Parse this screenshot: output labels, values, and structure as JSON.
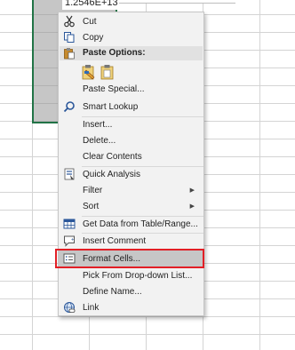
{
  "cell": {
    "value": "1.2546E+13"
  },
  "context_menu": {
    "items": [
      {
        "id": "cut",
        "label": "Cut",
        "icon": "scissors-icon"
      },
      {
        "id": "copy",
        "label": "Copy",
        "icon": "copy-icon"
      },
      {
        "id": "paste_options",
        "label": "Paste Options:",
        "icon": "paste-icon"
      },
      {
        "id": "paste_special",
        "label": "Paste Special..."
      },
      {
        "id": "smart_lookup",
        "label": "Smart Lookup",
        "icon": "search-icon"
      },
      {
        "id": "insert",
        "label": "Insert..."
      },
      {
        "id": "delete",
        "label": "Delete..."
      },
      {
        "id": "clear_contents",
        "label": "Clear Contents"
      },
      {
        "id": "quick_analysis",
        "label": "Quick Analysis",
        "icon": "quick-analysis-icon"
      },
      {
        "id": "filter",
        "label": "Filter"
      },
      {
        "id": "sort",
        "label": "Sort"
      },
      {
        "id": "get_data",
        "label": "Get Data from Table/Range...",
        "icon": "table-icon"
      },
      {
        "id": "insert_comment",
        "label": "Insert Comment",
        "icon": "comment-icon"
      },
      {
        "id": "format_cells",
        "label": "Format Cells...",
        "icon": "format-cells-icon",
        "highlighted": true
      },
      {
        "id": "pick_dropdown",
        "label": "Pick From Drop-down List..."
      },
      {
        "id": "define_name",
        "label": "Define Name..."
      },
      {
        "id": "link",
        "label": "Link",
        "icon": "link-icon"
      }
    ],
    "submenu_arrow": "▶"
  },
  "colors": {
    "selection_border": "#217346",
    "highlight_box": "#e21f26",
    "menu_background": "#f2f2f2"
  }
}
